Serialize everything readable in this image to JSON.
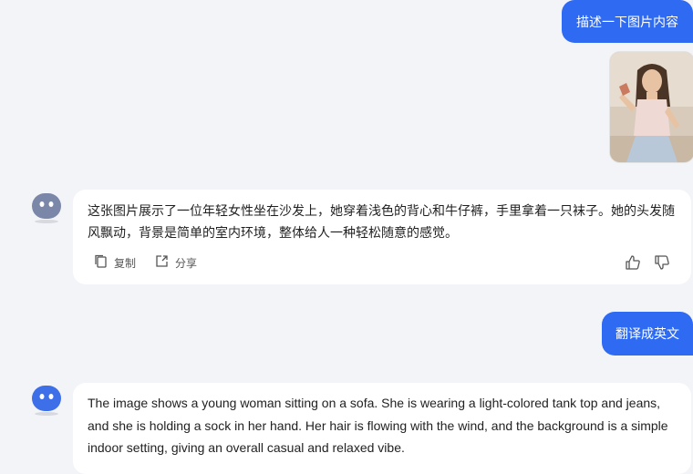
{
  "conversation": {
    "user_msg_1": "描述一下图片内容",
    "assistant_msg_1": "这张图片展示了一位年轻女性坐在沙发上，她穿着浅色的背心和牛仔裤，手里拿着一只袜子。她的头发随风飘动，背景是简单的室内环境，整体给人一种轻松随意的感觉。",
    "actions": {
      "copy": "复制",
      "share": "分享"
    },
    "user_msg_2": "翻译成英文",
    "assistant_msg_2": "The image shows a young woman sitting on a sofa. She is wearing a light-colored tank top and jeans, and she is holding a sock in her hand. Her hair is flowing with the wind, and the background is a simple indoor setting, giving an overall casual and relaxed vibe."
  },
  "icons": [
    "bot-avatar-icon",
    "copy-icon",
    "share-icon",
    "thumbs-up-icon",
    "thumbs-down-icon"
  ],
  "colors": {
    "accent": "#2f6bf2",
    "background": "#f3f4f8",
    "card": "#ffffff"
  }
}
